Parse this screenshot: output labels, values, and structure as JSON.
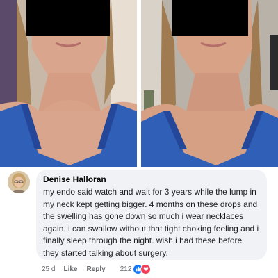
{
  "comment": {
    "author": "Denise Halloran",
    "text": "my endo said watch and wait for 3 years while the lump in my neck kept getting bigger. 4 months on these drops and the swelling has gone down so much i wear necklaces again. i can swallow without that tight choking feeling and i finally sleep through the night. wish i had these before they started talking about surgery.",
    "timestamp": "25 d",
    "like_label": "Like",
    "reply_label": "Reply",
    "reaction_count": "212",
    "reactions": [
      "like-icon",
      "love-icon"
    ]
  },
  "colors": {
    "bubble_background": "#f0f2f5",
    "like_blue": "#1877f2",
    "love_red": "#f33e58",
    "meta_gray": "#65676b",
    "censor_bar": "#000000"
  }
}
